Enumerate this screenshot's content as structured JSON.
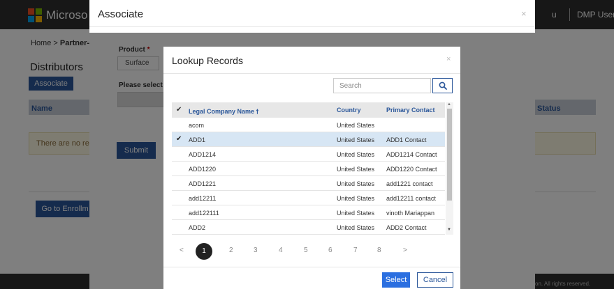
{
  "background": {
    "brand": "Microso",
    "header_user": "DMP User ▾",
    "header_partial": "u",
    "breadcrumb_home": "Home",
    "breadcrumb_sep": ">",
    "breadcrumb_current": "Partner-",
    "page_title": "Distributors",
    "associate_button": "Associate",
    "col_name": "Name",
    "col_status": "Status",
    "empty_message": "There are no reco",
    "goto_button": "Go to Enrollm",
    "footer_text": "on. All rights reserved."
  },
  "associate_modal": {
    "title": "Associate",
    "close": "×",
    "product_label": "Product",
    "required_mark": "*",
    "product_value": "Surface",
    "please_select_label": "Please select t",
    "submit_button": "Submit"
  },
  "lookup_modal": {
    "title": "Lookup Records",
    "close": "×",
    "search_placeholder": "Search",
    "columns": {
      "check": "✔",
      "name": "Legal Company Name",
      "sort_icon": "🠕",
      "country": "Country",
      "contact": "Primary Contact"
    },
    "rows": [
      {
        "check": "",
        "name": "acom",
        "country": "United States",
        "contact": ""
      },
      {
        "check": "✔",
        "name": "ADD1",
        "country": "United States",
        "contact": "ADD1 Contact"
      },
      {
        "check": "",
        "name": "ADD1214",
        "country": "United States",
        "contact": "ADD1214 Contact"
      },
      {
        "check": "",
        "name": "ADD1220",
        "country": "United States",
        "contact": "ADD1220 Contact"
      },
      {
        "check": "",
        "name": "ADD1221",
        "country": "United States",
        "contact": "add1221 contact"
      },
      {
        "check": "",
        "name": "add12211",
        "country": "United States",
        "contact": "add12211 contact"
      },
      {
        "check": "",
        "name": "add122111",
        "country": "United States",
        "contact": "vinoth Mariappan"
      },
      {
        "check": "",
        "name": "ADD2",
        "country": "United States",
        "contact": "ADD2 Contact"
      }
    ],
    "pager": {
      "prev": "<",
      "pages": [
        "1",
        "2",
        "3",
        "4",
        "5",
        "6",
        "7",
        "8"
      ],
      "current": "1",
      "next": ">"
    },
    "select_button": "Select",
    "cancel_button": "Cancel"
  },
  "colors": {
    "primary": "#2b579a",
    "select_button": "#2b6fe0",
    "selected_row": "#d7e6f4",
    "header_bar": "#2f2f2f"
  },
  "icons": {
    "search": "search-icon",
    "close": "close-icon",
    "check": "check-icon",
    "sort": "sort-asc-icon"
  }
}
